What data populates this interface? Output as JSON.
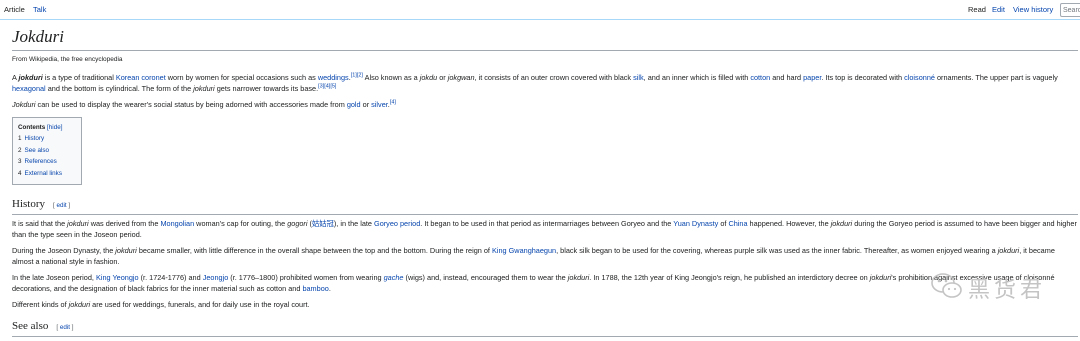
{
  "tabs": {
    "left": [
      "Article",
      "Talk"
    ],
    "right": [
      "Read",
      "Edit",
      "View history"
    ],
    "search_placeholder": "Search"
  },
  "title": "Jokduri",
  "tagline": "From Wikipedia, the free encyclopedia",
  "toc": {
    "title": "Contents",
    "hide": "[hide]",
    "items": [
      {
        "n": "1",
        "label": "History"
      },
      {
        "n": "2",
        "label": "See also"
      },
      {
        "n": "3",
        "label": "References"
      },
      {
        "n": "4",
        "label": "External links"
      }
    ]
  },
  "sections": {
    "history": "History",
    "see_also": "See also",
    "edit": "[ edit ]"
  },
  "watermark": "黑货君"
}
